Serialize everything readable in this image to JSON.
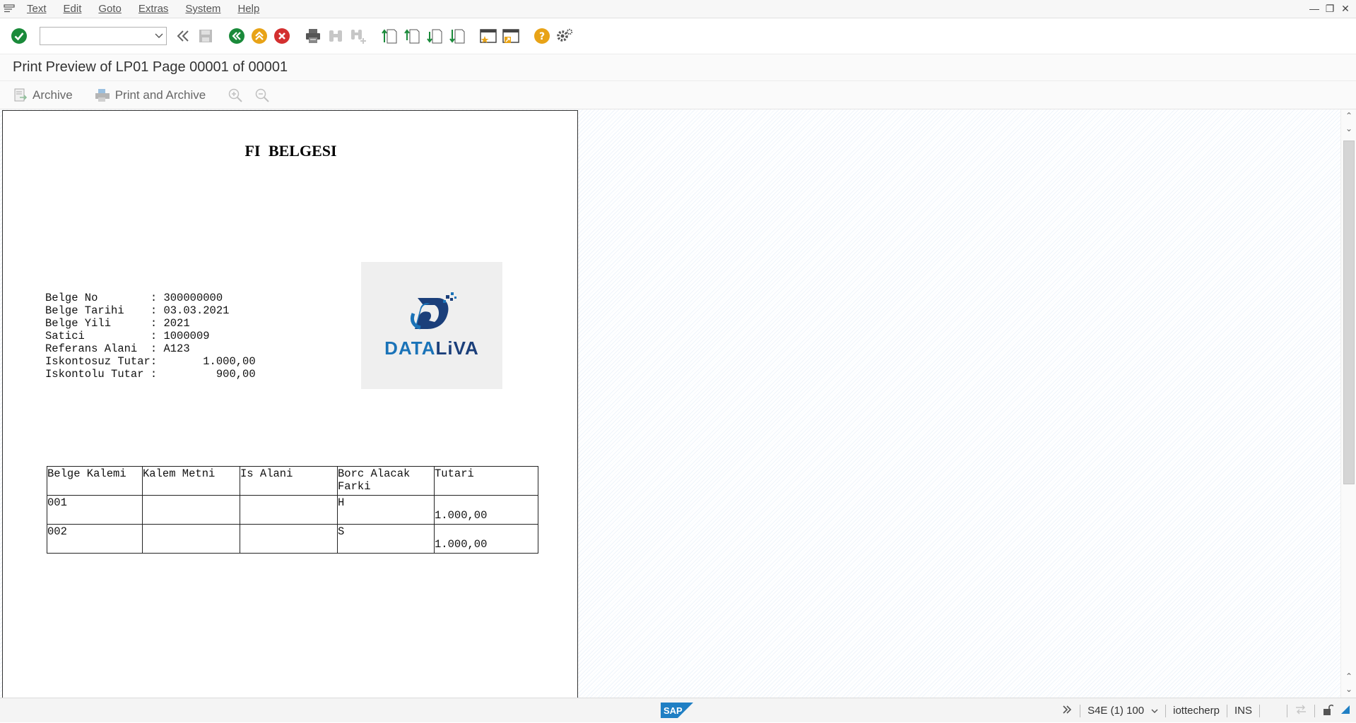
{
  "menu": {
    "items": [
      {
        "label": "Text"
      },
      {
        "label": "Edit"
      },
      {
        "label": "Goto"
      },
      {
        "label": "Extras"
      },
      {
        "label": "System"
      },
      {
        "label": "Help"
      }
    ]
  },
  "toolbar": {
    "command_field": {
      "value": "",
      "placeholder": ""
    }
  },
  "title": "Print Preview of LP01 Page 00001 of 00001",
  "app_toolbar": {
    "archive_label": "Archive",
    "print_archive_label": "Print and Archive"
  },
  "document": {
    "title": "FI  BELGESI",
    "fields": [
      {
        "label": "Belge No        ",
        "sep": ": ",
        "value": "300000000"
      },
      {
        "label": "Belge Tarihi    ",
        "sep": ": ",
        "value": "03.03.2021"
      },
      {
        "label": "Belge Yili      ",
        "sep": ": ",
        "value": "2021"
      },
      {
        "label": "Satici          ",
        "sep": ": ",
        "value": "1000009"
      },
      {
        "label": "Referans Alani  ",
        "sep": ": ",
        "value": "A123"
      },
      {
        "label": "Iskontosuz Tutar",
        "sep": ":       ",
        "value": "1.000,00"
      },
      {
        "label": "Iskontolu Tutar ",
        "sep": ":         ",
        "value": "900,00"
      }
    ],
    "logo_text_left": "DATA",
    "logo_text_right": "LiVA",
    "table": {
      "headers": [
        "Belge Kalemi",
        "Kalem Metni",
        "Is Alani",
        "Borc Alacak Farki",
        "Tutari"
      ],
      "rows": [
        [
          "001",
          "",
          "",
          "H",
          "1.000,00"
        ],
        [
          "002",
          "",
          "",
          "S",
          "1.000,00"
        ]
      ]
    }
  },
  "status": {
    "system": "S4E (1) 100",
    "server": "iottecherp",
    "mode": "INS"
  },
  "colors": {
    "accent_green": "#1a8a3a",
    "accent_orange": "#e8a317",
    "accent_red": "#d32f2f",
    "logo_blue": "#1a73b8",
    "logo_dark": "#1b3f7a"
  }
}
